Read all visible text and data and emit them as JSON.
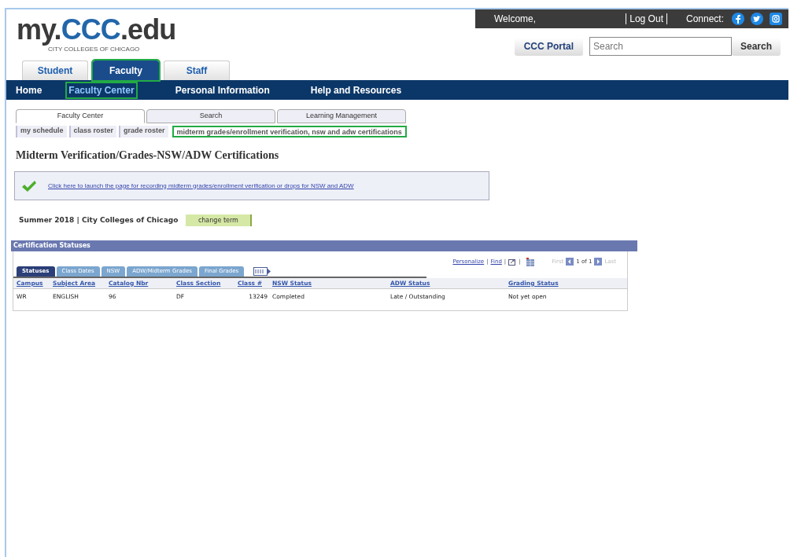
{
  "top_bar": {
    "welcome": "Welcome,",
    "logout": "Log Out",
    "connect": "Connect:"
  },
  "logo": {
    "my": "my.",
    "ccc": "CCC",
    "edu": ".edu",
    "subtitle": "CITY COLLEGES OF CHICAGO"
  },
  "portal_button": "CCC Portal",
  "search": {
    "placeholder": "Search",
    "button": "Search"
  },
  "role_tabs": [
    {
      "label": "Student",
      "selected": false,
      "highlighted": false
    },
    {
      "label": "Faculty",
      "selected": true,
      "highlighted": true
    },
    {
      "label": "Staff",
      "selected": false,
      "highlighted": false
    }
  ],
  "nav": [
    {
      "label": "Home",
      "selected": false,
      "highlighted": false
    },
    {
      "label": "Faculty Center",
      "selected": true,
      "highlighted": true
    },
    {
      "label": "Personal Information",
      "selected": false,
      "highlighted": false
    },
    {
      "label": "Help and Resources",
      "selected": false,
      "highlighted": false
    }
  ],
  "page_tabs": [
    {
      "label": "Faculty Center",
      "selected": true
    },
    {
      "label": "Search",
      "selected": false
    },
    {
      "label": "Learning Management",
      "selected": false
    }
  ],
  "sub_links": [
    {
      "label": "my schedule",
      "highlighted": false
    },
    {
      "label": "class roster",
      "highlighted": false
    },
    {
      "label": "grade roster",
      "highlighted": false
    },
    {
      "label": "midterm grades/enrollment verification, nsw and adw certifications",
      "highlighted": true
    }
  ],
  "heading": "Midterm Verification/Grades-NSW/ADW Certifications",
  "message_link": "Click here to launch the page for recording midterm grades/enrollment verification or drops for NSW and ADW",
  "term": "Summer 2018 | City Colleges of Chicago",
  "change_term": "change term",
  "grid": {
    "title": "Certification Statuses",
    "separator": "|",
    "personalize": "Personalize",
    "find": "Find",
    "first": "First",
    "count": "1 of 1",
    "last": "Last",
    "tabs": [
      {
        "label": "Statuses",
        "selected": true
      },
      {
        "label": "Class Dates",
        "selected": false
      },
      {
        "label": "NSW",
        "selected": false
      },
      {
        "label": "ADW/Midterm Grades",
        "selected": false
      },
      {
        "label": "Final Grades",
        "selected": false
      }
    ],
    "columns": [
      "Campus",
      "Subject Area",
      "Catalog Nbr",
      "Class Section",
      "Class #",
      "NSW Status",
      "ADW Status",
      "Grading Status"
    ],
    "rows": [
      [
        "WR",
        "ENGLISH",
        "96",
        "DF",
        "13249",
        "Completed",
        "Late / Outstanding",
        "Not yet open"
      ]
    ]
  }
}
